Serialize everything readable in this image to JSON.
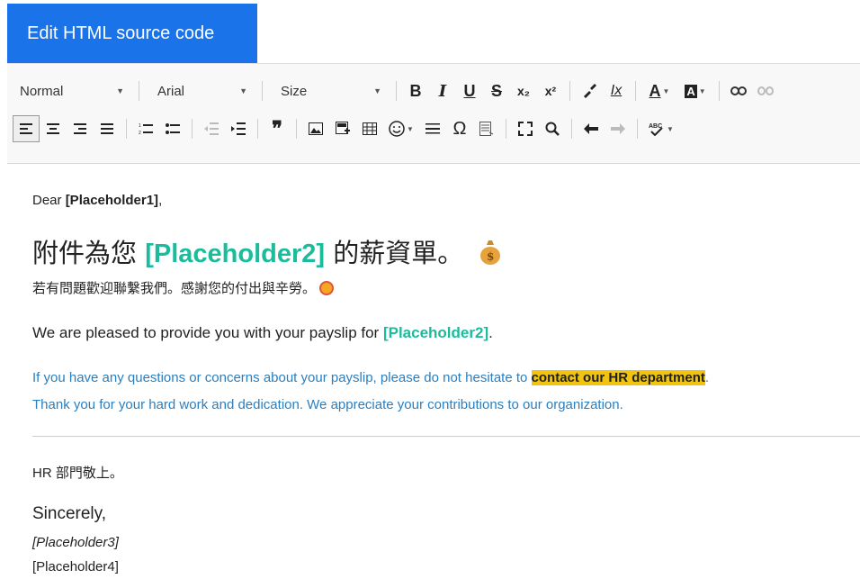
{
  "tabs": {
    "active_label": "Edit HTML source code"
  },
  "toolbar": {
    "format_value": "Normal",
    "font_value": "Arial",
    "size_value": "Size",
    "bold": "B",
    "italic": "I",
    "underline": "U",
    "strike": "S",
    "subscript": "x₂",
    "superscript": "x²",
    "clear_format": "Ix",
    "text_color": "A",
    "bg_color": "A",
    "blockquote": "❞",
    "special_char": "Ω"
  },
  "editor": {
    "dear_prefix": "Dear ",
    "dear_placeholder": "[Placeholder1]",
    "dear_suffix": ",",
    "headline_prefix": "附件為您 ",
    "headline_placeholder": "[Placeholder2]",
    "headline_suffix": " 的薪資單。",
    "subline": "若有問題歡迎聯繫我們。感謝您的付出與辛勞。",
    "english_line_prefix": "We are pleased to provide you with your payslip for ",
    "english_line_placeholder": "[Placeholder2]",
    "english_line_suffix": ".",
    "blue_line1_prefix": "If you have any questions or concerns about your payslip, please do not hesitate to ",
    "blue_line1_highlight": "contact our HR department",
    "blue_line1_suffix": ".",
    "blue_line2": "Thank you for your hard work and dedication. We appreciate your contributions to our organization.",
    "signoff_cn": "HR 部門敬上。",
    "sincerely": "Sincerely,",
    "placeholder3": "[Placeholder3]",
    "placeholder4": "[Placeholder4]"
  },
  "colors": {
    "accent": "#1a73e8",
    "placeholder": "#1abc9c",
    "blue_text": "#2a7fc1",
    "highlight": "#f1c40f"
  }
}
